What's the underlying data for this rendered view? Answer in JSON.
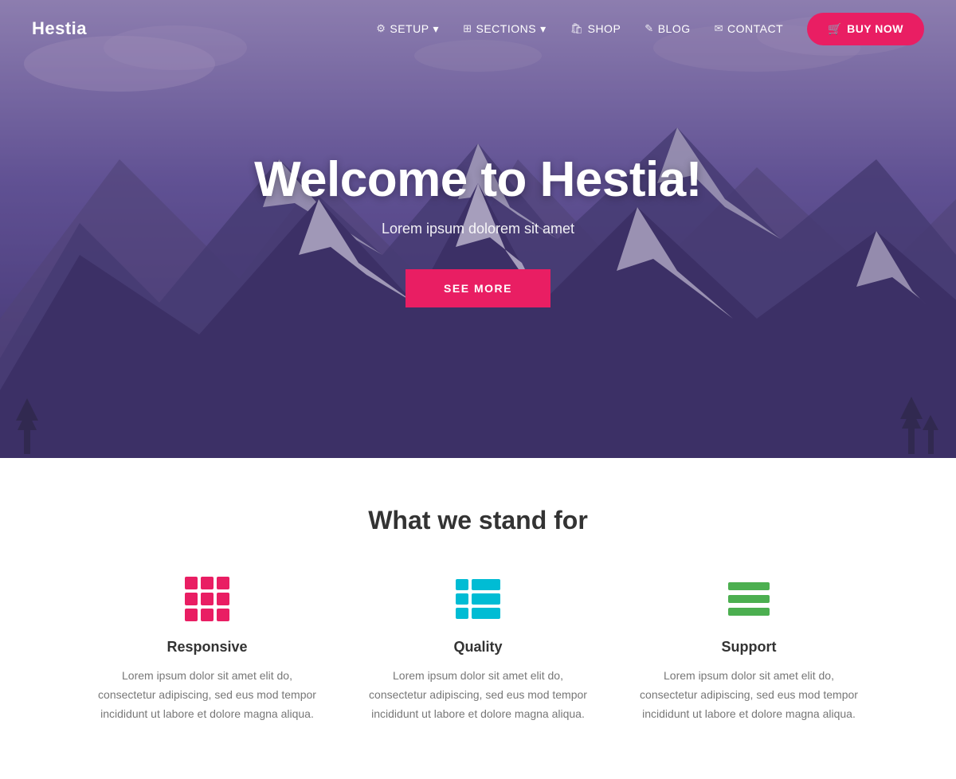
{
  "brand": "Hestia",
  "nav": {
    "items": [
      {
        "label": "SETUP",
        "icon": "⚙",
        "hasDropdown": true
      },
      {
        "label": "SECTIONS",
        "icon": "⊞",
        "hasDropdown": true
      },
      {
        "label": "SHOP",
        "icon": "🛍"
      },
      {
        "label": "BLOG",
        "icon": "✎"
      },
      {
        "label": "CONTACT",
        "icon": "✉"
      }
    ],
    "buyButton": "BUY NOW",
    "buyIcon": "🛒"
  },
  "hero": {
    "title": "Welcome to Hestia!",
    "subtitle": "Lorem ipsum dolorem sit amet",
    "cta": "SEE MORE"
  },
  "features": {
    "title": "What we stand for",
    "items": [
      {
        "name": "Responsive",
        "desc": "Lorem ipsum dolor sit amet elit do, consectetur adipiscing, sed eus mod tempor incididunt ut labore et dolore magna aliqua.",
        "icon": "grid"
      },
      {
        "name": "Quality",
        "desc": "Lorem ipsum dolor sit amet elit do, consectetur adipiscing, sed eus mod tempor incididunt ut labore et dolore magna aliqua.",
        "icon": "table"
      },
      {
        "name": "Support",
        "desc": "Lorem ipsum dolor sit amet elit do, consectetur adipiscing, sed eus mod tempor incididunt ut labore et dolore magna aliqua.",
        "icon": "lines"
      }
    ]
  }
}
